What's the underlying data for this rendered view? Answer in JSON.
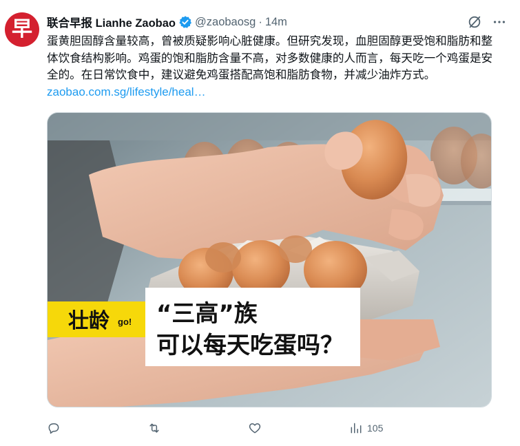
{
  "avatar": {
    "glyph": "早",
    "bg": "#d4202f"
  },
  "author": {
    "name": "联合早报 Lianhe Zaobao",
    "handle": "@zaobaosg",
    "separator": "·",
    "time": "14m"
  },
  "tweet": {
    "text": "蛋黄胆固醇含量较高，曾被质疑影响心脏健康。但研究发现，血胆固醇更受饱和脂肪和整体饮食结构影响。鸡蛋的饱和脂肪含量不高，对多数健康的人而言，每天吃一个鸡蛋是安全的。在日常饮食中，建议避免鸡蛋搭配高饱和脂肪食物，并减少油炸方式。",
    "link": "zaobao.com.sg/lifestyle/heal…"
  },
  "media": {
    "badge_text": "壮龄",
    "badge_go": "go!",
    "headline_line1": "“三高”族",
    "headline_line2": "可以每天吃蛋吗？"
  },
  "actions": {
    "views_count": "105"
  },
  "colors": {
    "link": "#1d9bf0",
    "muted": "#536471",
    "verified": "#1d9bf0",
    "badge_yellow": "#f6d80a"
  },
  "icons": {
    "verified": "verified-badge-icon",
    "grok": "grok-icon",
    "more": "more-icon",
    "reply": "reply-icon",
    "retweet": "retweet-icon",
    "like": "like-icon",
    "views": "views-icon"
  }
}
